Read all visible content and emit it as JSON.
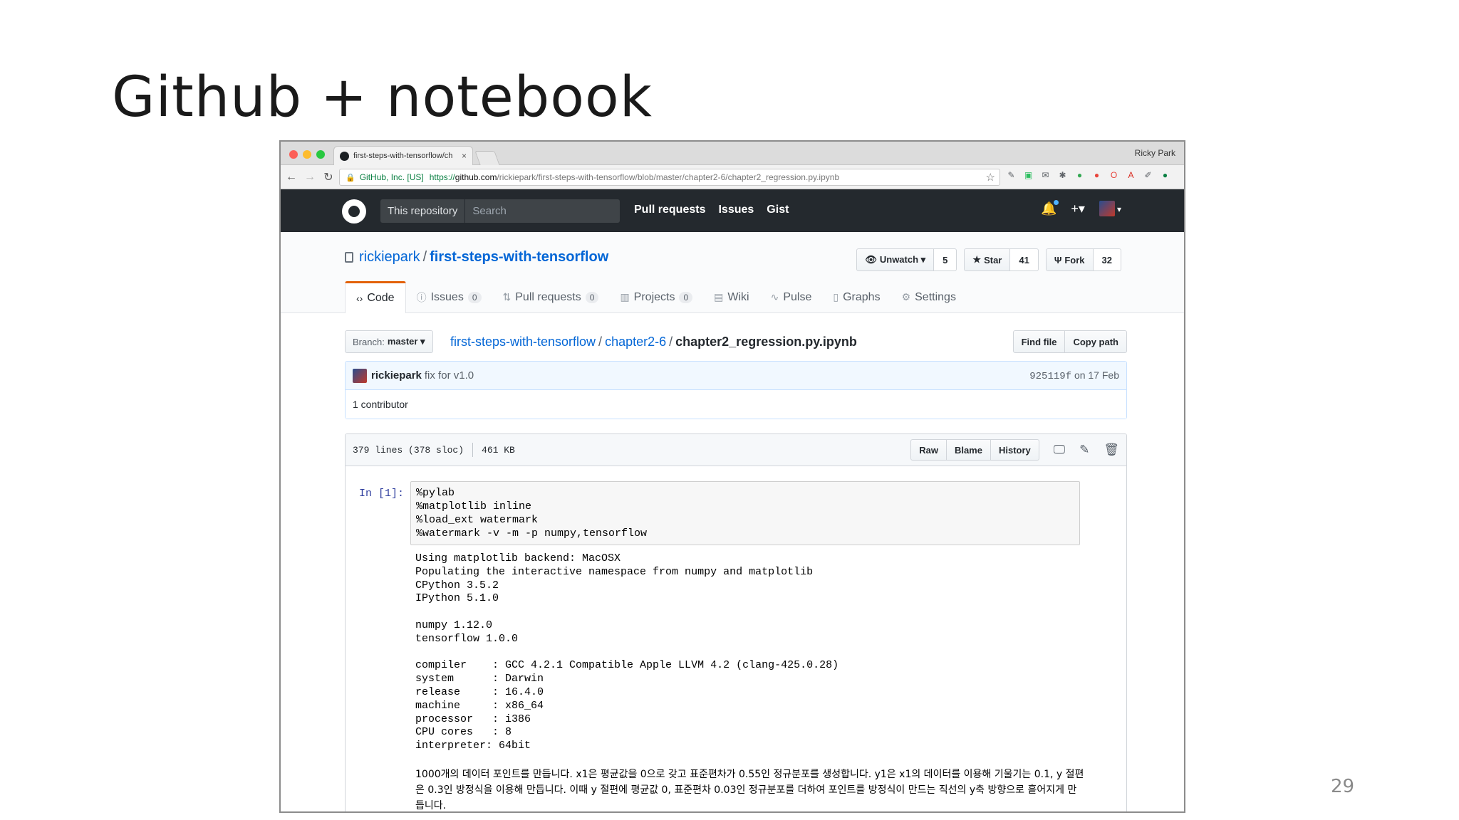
{
  "slide": {
    "title": "Github + notebook",
    "page_number": "29"
  },
  "browser": {
    "tab_title": "first-steps-with-tensorflow/ch",
    "tab_close": "×",
    "profile_name": "Ricky Park",
    "secure_label": "GitHub, Inc. [US]",
    "url_scheme": "https://",
    "url_host": "github.com",
    "url_path": "/rickiepark/first-steps-with-tensorflow/blob/master/chapter2-6/chapter2_regression.py.ipynb",
    "back_glyph": "←",
    "forward_glyph": "→",
    "reload_glyph": "↻",
    "star_glyph": "☆",
    "extensions": [
      {
        "icon": "pin-icon",
        "glyph": "✎",
        "color": "#5f6368"
      },
      {
        "icon": "evernote-icon",
        "glyph": "▣",
        "color": "#2dbe60"
      },
      {
        "icon": "mail-icon",
        "glyph": "✉",
        "color": "#5f6368"
      },
      {
        "icon": "puzzle-icon",
        "glyph": "✱",
        "color": "#5f6368"
      },
      {
        "icon": "green-circle-icon",
        "glyph": "●",
        "color": "#34a853"
      },
      {
        "icon": "adblock-icon",
        "glyph": "●",
        "color": "#e8453c"
      },
      {
        "icon": "opera-icon",
        "glyph": "O",
        "color": "#e8453c"
      },
      {
        "icon": "acrobat-icon",
        "glyph": "A",
        "color": "#d93025"
      },
      {
        "icon": "eyedropper-icon",
        "glyph": "✐",
        "color": "#5f6368"
      },
      {
        "icon": "green-dot-icon",
        "glyph": "●",
        "color": "#0b8043"
      }
    ]
  },
  "github": {
    "search_scope": "This repository",
    "search_placeholder": "Search",
    "nav": [
      "Pull requests",
      "Issues",
      "Gist"
    ],
    "plus_glyph": "+▾",
    "bell_glyph": "🔔",
    "avatar_caret": "▾"
  },
  "repo": {
    "owner": "rickiepark",
    "separator": "/",
    "name": "first-steps-with-tensorflow",
    "unwatch_label": "Unwatch ▾",
    "watch_count": "5",
    "star_label": "Star",
    "star_count": "41",
    "fork_label": "Fork",
    "fork_count": "32",
    "tabs": [
      {
        "icon": "code-icon",
        "glyph": "‹›",
        "label": "Code",
        "count": ""
      },
      {
        "icon": "issue-icon",
        "glyph": "ⓘ",
        "label": "Issues",
        "count": "0"
      },
      {
        "icon": "pull-request-icon",
        "glyph": "⇅",
        "label": "Pull requests",
        "count": "0"
      },
      {
        "icon": "projects-icon",
        "glyph": "▥",
        "label": "Projects",
        "count": "0"
      },
      {
        "icon": "wiki-icon",
        "glyph": "▤",
        "label": "Wiki",
        "count": ""
      },
      {
        "icon": "pulse-icon",
        "glyph": "∿",
        "label": "Pulse",
        "count": ""
      },
      {
        "icon": "graph-icon",
        "glyph": "▯",
        "label": "Graphs",
        "count": ""
      },
      {
        "icon": "gear-icon",
        "glyph": "⚙",
        "label": "Settings",
        "count": ""
      }
    ]
  },
  "file_nav": {
    "branch_prefix": "Branch:",
    "branch_name": "master ▾",
    "breadcrumb_root": "first-steps-with-tensorflow",
    "breadcrumb_dir": "chapter2-6",
    "breadcrumb_sep": "/",
    "breadcrumb_file": "chapter2_regression.py.ipynb",
    "find_file": "Find file",
    "copy_path": "Copy path"
  },
  "commit": {
    "author": "rickiepark",
    "message": "fix for v1.0",
    "sha": "925119f",
    "date": "on 17 Feb",
    "contributors": "1 contributor"
  },
  "file": {
    "lines": "379 lines (378 sloc)",
    "size": "461 KB",
    "raw": "Raw",
    "blame": "Blame",
    "history": "History",
    "desktop_glyph": "🖵",
    "edit_glyph": "✎",
    "trash_glyph": "🗑"
  },
  "notebook": {
    "prompt": "In [1]:",
    "input_code": "%pylab\n%matplotlib inline\n%load_ext watermark\n%watermark -v -m -p numpy,tensorflow",
    "output_text": "Using matplotlib backend: MacOSX\nPopulating the interactive namespace from numpy and matplotlib\nCPython 3.5.2\nIPython 5.1.0\n\nnumpy 1.12.0\ntensorflow 1.0.0\n\ncompiler    : GCC 4.2.1 Compatible Apple LLVM 4.2 (clang-425.0.28)\nsystem      : Darwin\nrelease     : 16.4.0\nmachine     : x86_64\nprocessor   : i386\nCPU cores   : 8\ninterpreter: 64bit",
    "markdown": "1000개의 데이터 포인트를 만듭니다. x1은 평균값을 0으로 갖고 표준편차가 0.55인 정규분포를 생성합니다. y1은 x1의 데이터를 이용해 기울기는 0.1, y 절편은 0.3인 방정식을 이용해 만듭니다. 이때 y 절편에 평균값 0, 표준편차 0.03인 정규분포를 더하여 포인트를 방정식이 만드는 직선의 y축 방향으로 흩어지게 만듭니다."
  }
}
